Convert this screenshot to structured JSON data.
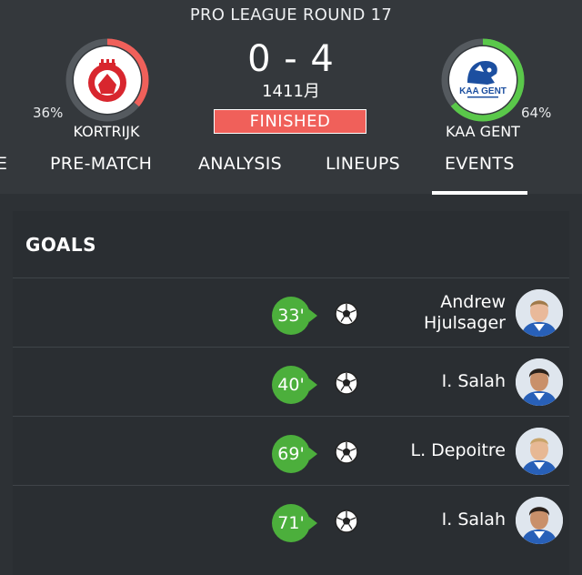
{
  "match": {
    "round": "PRO LEAGUE ROUND 17",
    "score": "0 - 4",
    "date": "1411月",
    "status": "FINISHED",
    "status_color": "#f0605a"
  },
  "home": {
    "name": "KORTRIJK",
    "percent": "36%",
    "percent_value": 0.36,
    "ring_color": "#f0605a",
    "logo": "kortrijk-crest"
  },
  "away": {
    "name": "KAA GENT",
    "percent": "64%",
    "percent_value": 0.64,
    "ring_color": "#5ac84a",
    "logo": "kaa-gent-crest",
    "logo_text": "KAA GENT"
  },
  "tabs": [
    {
      "label": "E",
      "active": false
    },
    {
      "label": "PRE-MATCH",
      "active": false
    },
    {
      "label": "ANALYSIS",
      "active": false
    },
    {
      "label": "LINEUPS",
      "active": false
    },
    {
      "label": "EVENTS",
      "active": true
    }
  ],
  "goals": {
    "title": "GOALS",
    "accent": "#4caf3c",
    "events": [
      {
        "minute": "33'",
        "player_line1": "Andrew",
        "player_line2": "Hjulsager",
        "icon": "soccer-ball-icon"
      },
      {
        "minute": "40'",
        "player_line1": "I. Salah",
        "player_line2": "",
        "icon": "soccer-ball-icon"
      },
      {
        "minute": "69'",
        "player_line1": "L. Depoitre",
        "player_line2": "",
        "icon": "soccer-ball-icon"
      },
      {
        "minute": "71'",
        "player_line1": "I. Salah",
        "player_line2": "",
        "icon": "soccer-ball-icon"
      }
    ]
  }
}
